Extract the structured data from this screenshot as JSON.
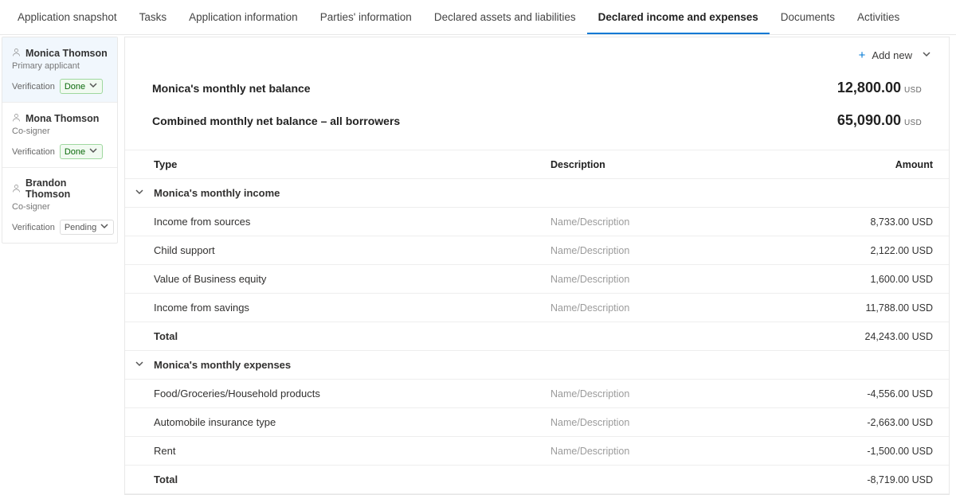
{
  "tabs": {
    "items": [
      {
        "label": "Application snapshot"
      },
      {
        "label": "Tasks"
      },
      {
        "label": "Application information"
      },
      {
        "label": "Parties' information"
      },
      {
        "label": "Declared assets and liabilities"
      },
      {
        "label": "Declared income and expenses"
      },
      {
        "label": "Documents"
      },
      {
        "label": "Activities"
      }
    ],
    "active_index": 5
  },
  "sidebar": {
    "verification_label": "Verification",
    "items": [
      {
        "name": "Monica Thomson",
        "role": "Primary applicant",
        "status": "Done",
        "status_kind": "done",
        "selected": true
      },
      {
        "name": "Mona Thomson",
        "role": "Co-signer",
        "status": "Done",
        "status_kind": "done",
        "selected": false
      },
      {
        "name": "Brandon Thomson",
        "role": "Co-signer",
        "status": "Pending",
        "status_kind": "pending",
        "selected": false
      }
    ]
  },
  "header": {
    "add_new_label": "Add new"
  },
  "summary": {
    "rows": [
      {
        "label": "Monica's monthly net balance",
        "amount": "12,800.00",
        "ccy": "USD"
      },
      {
        "label": "Combined monthly net balance – all borrowers",
        "amount": "65,090.00",
        "ccy": "USD"
      }
    ]
  },
  "grid": {
    "headers": {
      "type": "Type",
      "description": "Description",
      "amount": "Amount"
    },
    "desc_placeholder": "Name/Description",
    "sections": [
      {
        "title": "Monica's monthly income",
        "rows": [
          {
            "type": "Income from sources",
            "amount": "8,733.00 USD"
          },
          {
            "type": "Child support",
            "amount": "2,122.00 USD"
          },
          {
            "type": "Value of Business equity",
            "amount": "1,600.00 USD"
          },
          {
            "type": "Income from savings",
            "amount": "11,788.00 USD"
          }
        ],
        "total_label": "Total",
        "total_amount": "24,243.00  USD"
      },
      {
        "title": "Monica's monthly expenses",
        "rows": [
          {
            "type": "Food/Groceries/Household products",
            "amount": "-4,556.00 USD"
          },
          {
            "type": "Automobile insurance type",
            "amount": "-2,663.00 USD"
          },
          {
            "type": "Rent",
            "amount": "-1,500.00 USD"
          }
        ],
        "total_label": "Total",
        "total_amount": "-8,719.00 USD"
      }
    ]
  }
}
